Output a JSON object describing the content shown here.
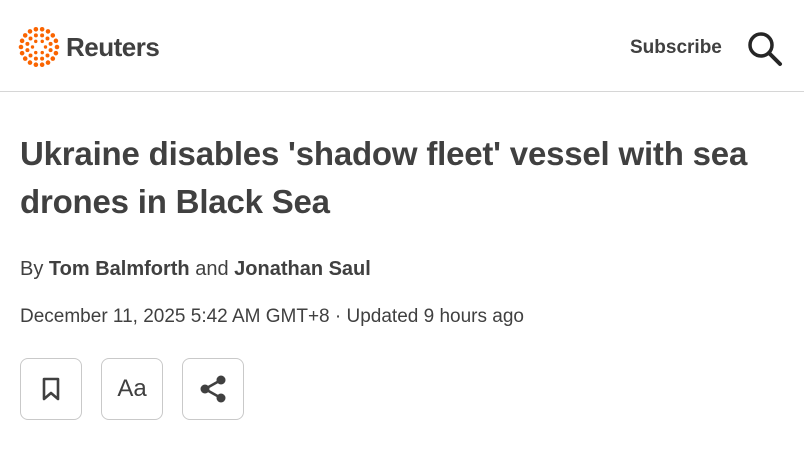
{
  "header": {
    "brand": "Reuters",
    "subscribe_label": "Subscribe"
  },
  "article": {
    "headline": "Ukraine disables 'shadow fleet' vessel with sea drones in Black Sea",
    "byline_prefix": "By",
    "byline_joiner": "and",
    "authors": [
      "Tom Balmforth",
      "Jonathan Saul"
    ],
    "dateline": "December 11, 2025 5:42 AM GMT+8 · Updated 9 hours ago"
  },
  "actions": {
    "text_size_label": "Aa"
  },
  "colors": {
    "text": "#404040",
    "logo_dots": "#fa6400",
    "divider": "#d6d6d6",
    "button_border": "#c9c9c9"
  },
  "icons": [
    "reuters-logo-icon",
    "search-icon",
    "bookmark-icon",
    "share-icon"
  ]
}
